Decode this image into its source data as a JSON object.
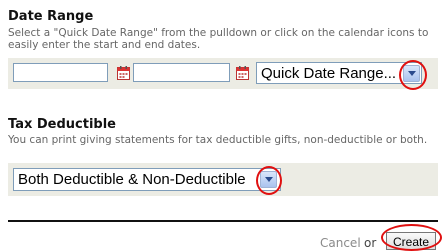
{
  "date_range": {
    "title": "Date Range",
    "help": "Select a \"Quick Date Range\" from the pulldown or click on the calendar icons to easily enter the start and end dates.",
    "start_date_value": "",
    "end_date_value": "",
    "quick_range_selected": "Quick Date Range..."
  },
  "tax_deductible": {
    "title": "Tax Deductible",
    "help": "You can print giving statements for tax deductible gifts, non-deductible or both.",
    "selected": "Both Deductible & Non-Deductible"
  },
  "actions": {
    "cancel_label": "Cancel",
    "or_label": "or",
    "create_label": "Create"
  },
  "colors": {
    "panel_bg": "#ecece4",
    "annotation": "#e01010",
    "input_border": "#7f9db9"
  },
  "icons": [
    "calendar-icon",
    "chevron-down-icon"
  ]
}
